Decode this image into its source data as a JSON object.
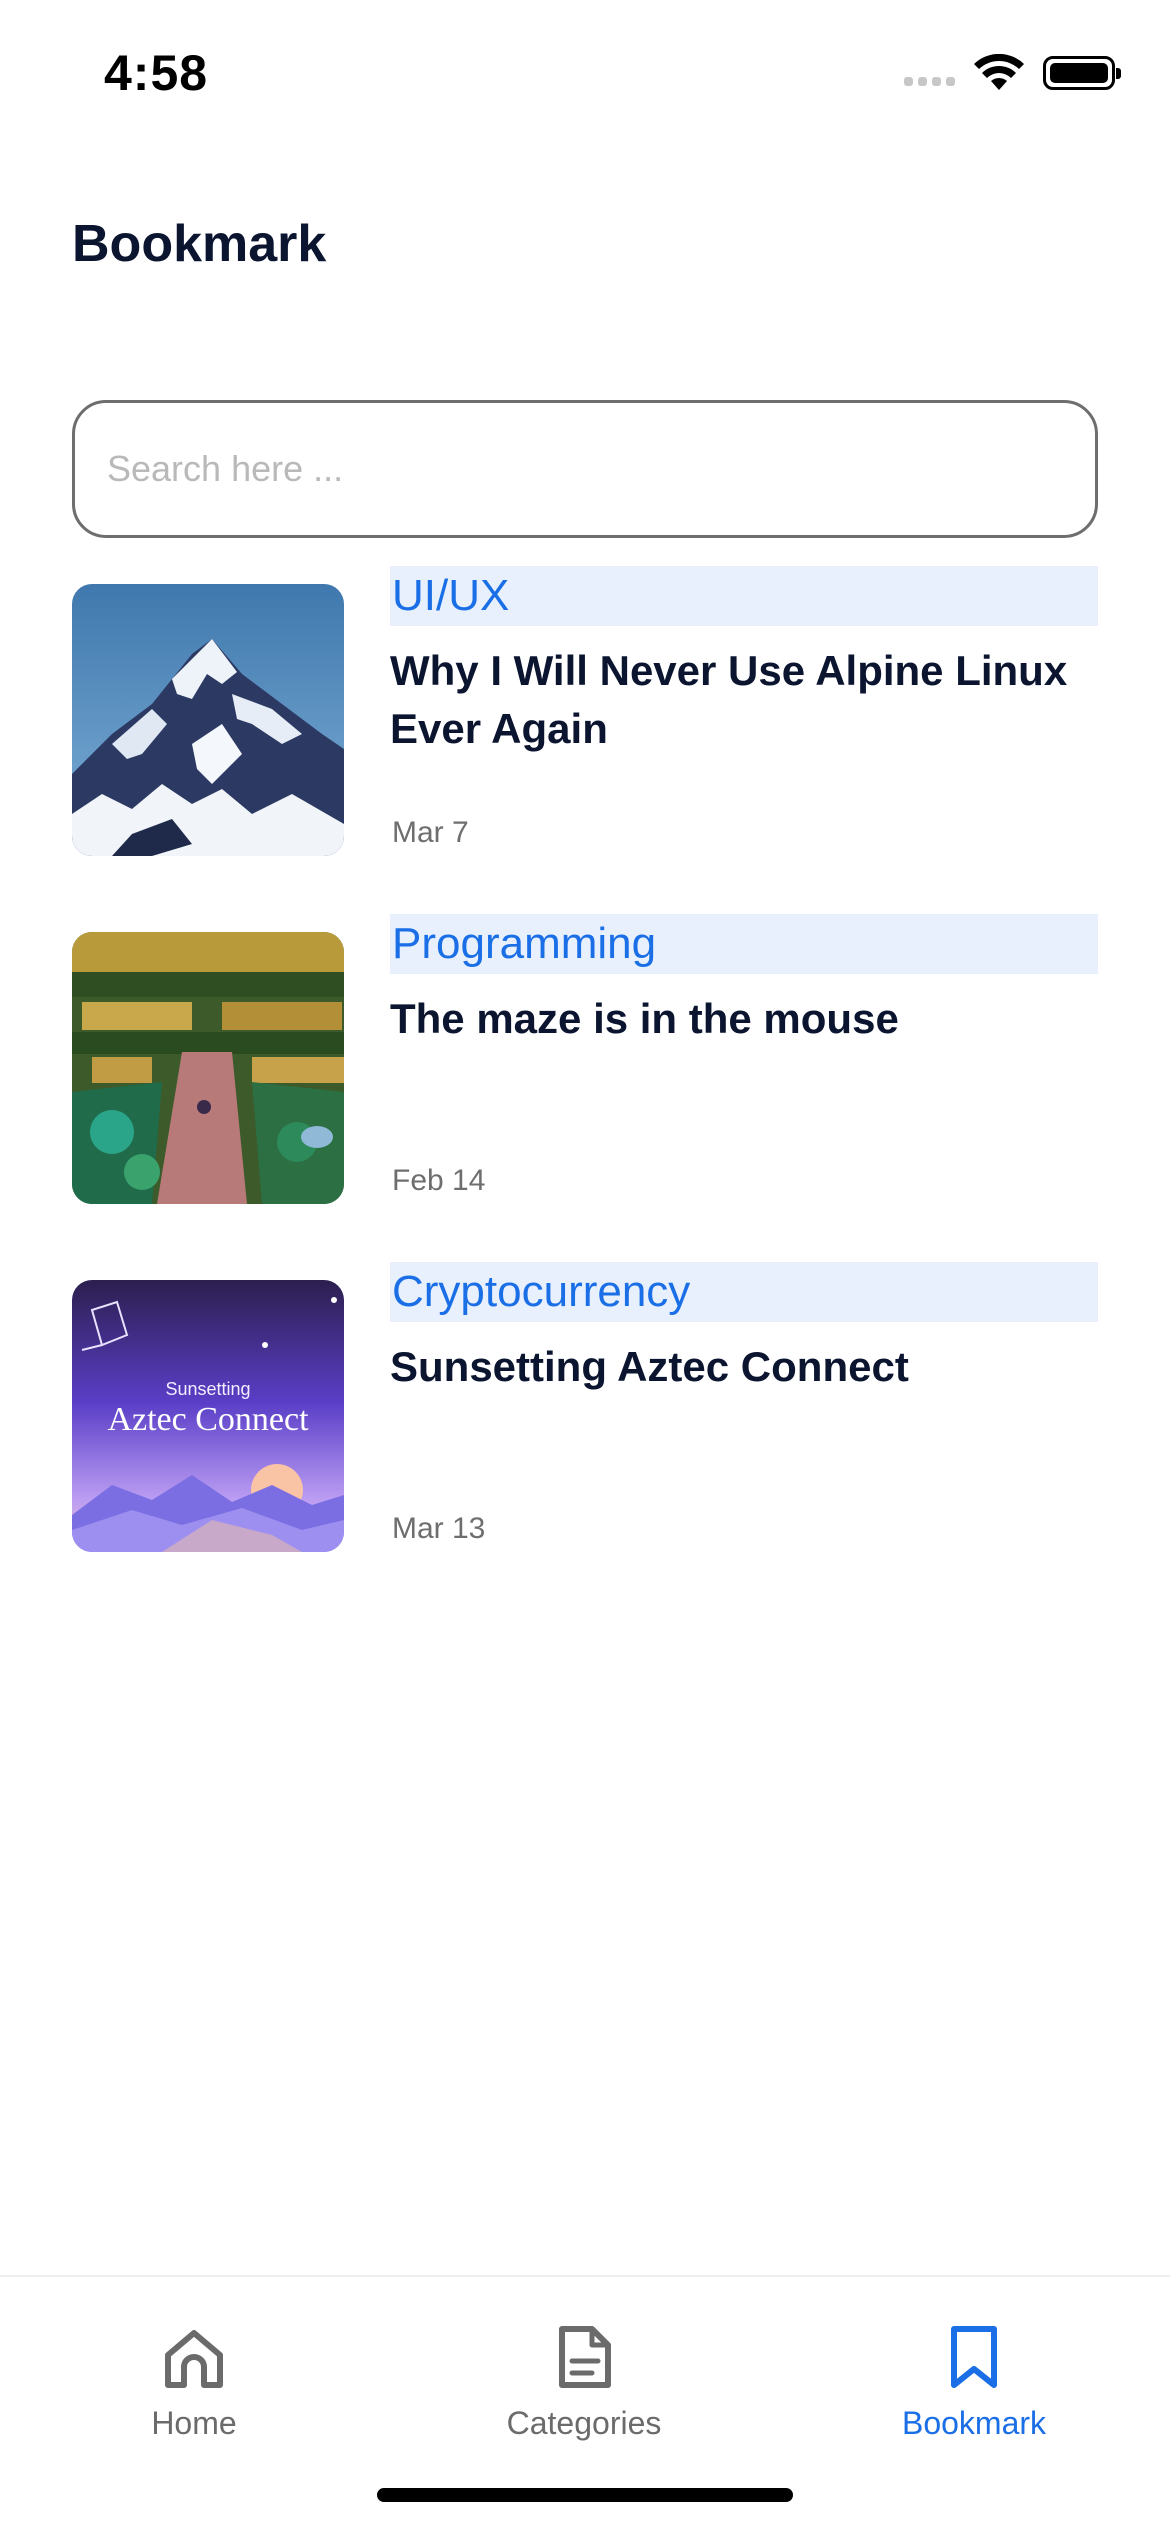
{
  "status_bar": {
    "time": "4:58",
    "icons": [
      "signal-icon",
      "wifi-icon",
      "battery-icon"
    ]
  },
  "header": {
    "title": "Bookmark"
  },
  "search": {
    "placeholder": "Search here ...",
    "value": ""
  },
  "articles": [
    {
      "category": "UI/UX",
      "title": "Why I Will Never Use Alpine Linux Ever Again",
      "date": "Mar 7",
      "thumbnail": "mountain-image"
    },
    {
      "category": "Programming",
      "title": "The maze is in the mouse",
      "date": "Feb 14",
      "thumbnail": "maze-image"
    },
    {
      "category": "Cryptocurrency",
      "title": "Sunsetting Aztec Connect",
      "date": "Mar 13",
      "thumbnail": "aztec-connect-image",
      "thumbnail_text": {
        "small": "Sunsetting",
        "large": "Aztec Connect"
      }
    }
  ],
  "bottom_nav": {
    "items": [
      {
        "label": "Home",
        "icon": "home-icon",
        "active": false
      },
      {
        "label": "Categories",
        "icon": "document-icon",
        "active": false
      },
      {
        "label": "Bookmark",
        "icon": "bookmark-icon",
        "active": true
      }
    ]
  },
  "colors": {
    "accent": "#1a6fe6",
    "category_bg": "#e8f0fd",
    "title": "#0b1530",
    "muted": "#6e6e6e"
  }
}
